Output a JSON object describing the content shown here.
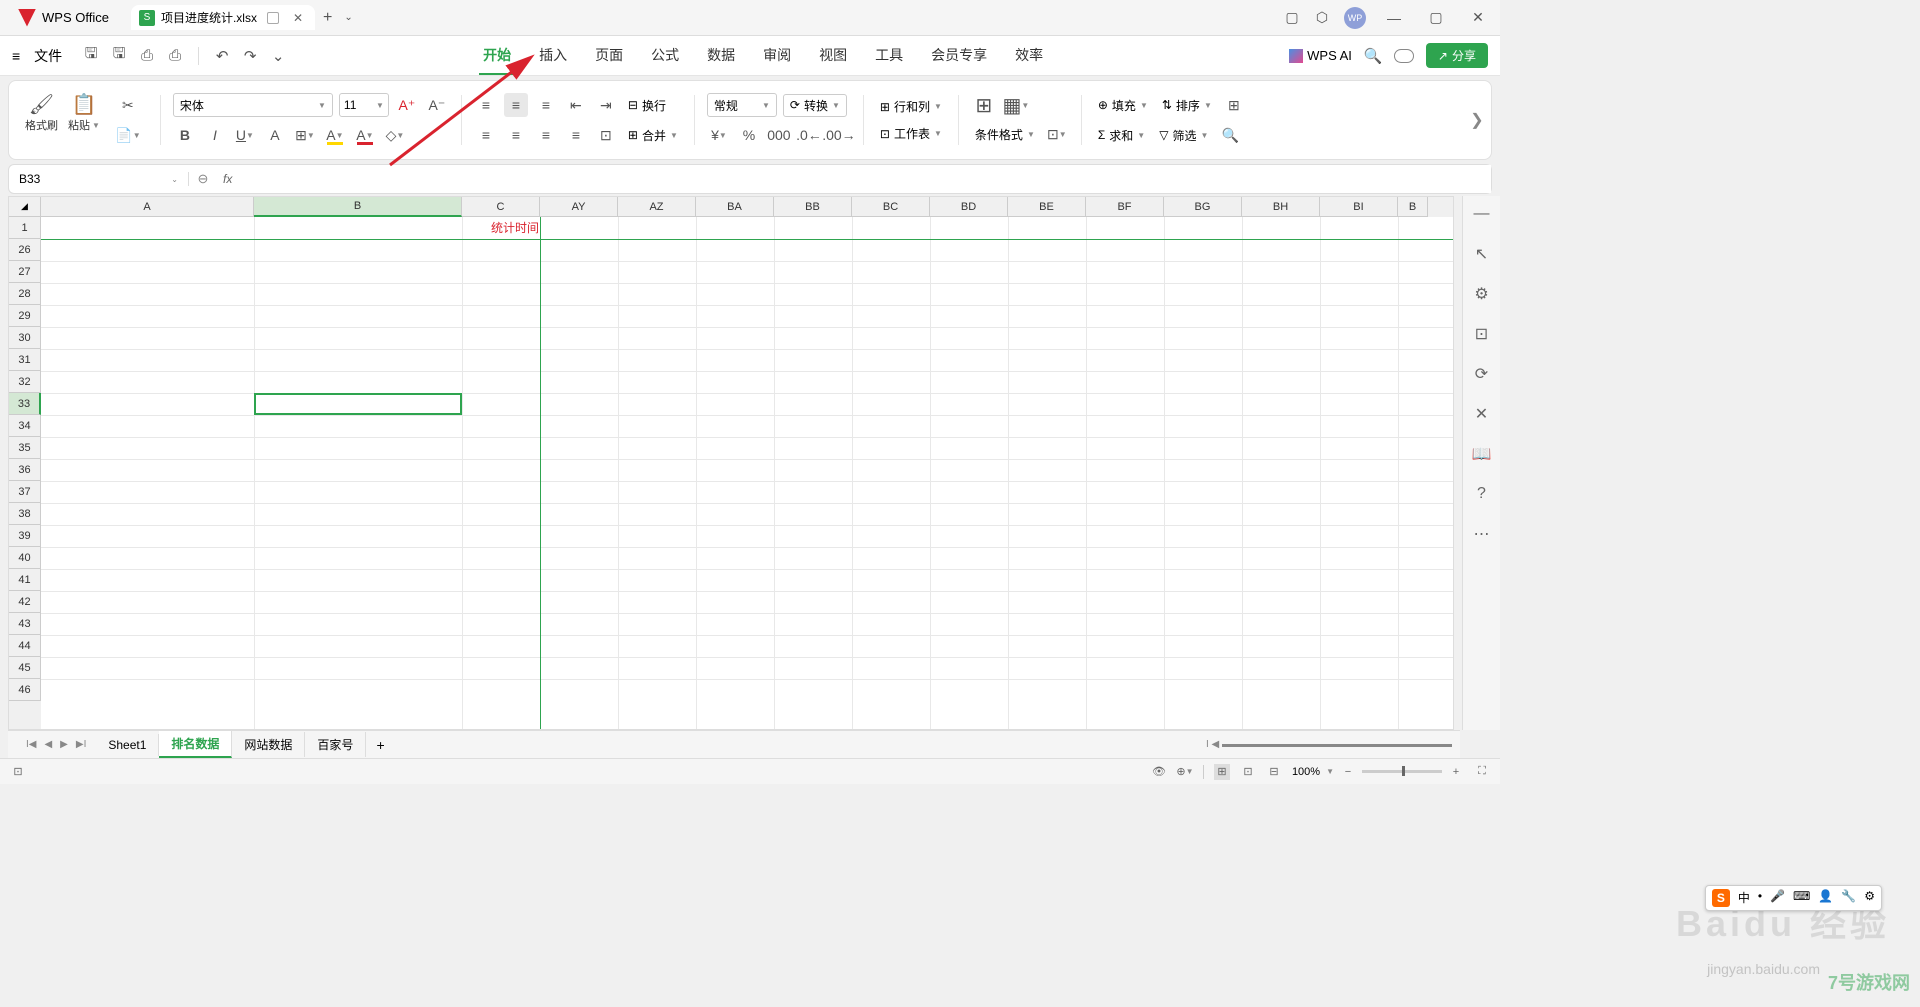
{
  "app": {
    "name": "WPS Office"
  },
  "document": {
    "name": "项目进度统计.xlsx",
    "icon_letter": "S"
  },
  "titlebar": {
    "avatar": "WP"
  },
  "menu": {
    "file": "文件",
    "tabs": [
      "开始",
      "插入",
      "页面",
      "公式",
      "数据",
      "审阅",
      "视图",
      "工具",
      "会员专享",
      "效率"
    ],
    "active": 0,
    "wps_ai": "WPS AI",
    "share": "分享"
  },
  "ribbon": {
    "format_painter": "格式刷",
    "paste": "粘贴",
    "font_name": "宋体",
    "font_size": "11",
    "wrap": "换行",
    "merge": "合并",
    "number_format": "常规",
    "convert": "转换",
    "rowcol": "行和列",
    "worksheet": "工作表",
    "cond_format": "条件格式",
    "fill": "填充",
    "sort": "排序",
    "sum": "求和",
    "filter": "筛选"
  },
  "namebox": {
    "value": "B33"
  },
  "columns": [
    "A",
    "B",
    "C",
    "AY",
    "AZ",
    "BA",
    "BB",
    "BC",
    "BD",
    "BE",
    "BF",
    "BG",
    "BH",
    "BI",
    "B"
  ],
  "rows": [
    "1",
    "26",
    "27",
    "28",
    "29",
    "30",
    "31",
    "32",
    "33",
    "34",
    "35",
    "36",
    "37",
    "38",
    "39",
    "40",
    "41",
    "42",
    "43",
    "44",
    "45",
    "46"
  ],
  "cell_c1": "统计时间",
  "sheets": {
    "tabs": [
      "Sheet1",
      "排名数据",
      "网站数据",
      "百家号"
    ],
    "active": 1
  },
  "status": {
    "zoom": "100%"
  },
  "watermark": {
    "text1": "Baidu 经验",
    "text2": "jingyan.baidu.com",
    "text3": "7号游戏网"
  },
  "ime": {
    "badge": "S",
    "mode": "中"
  }
}
